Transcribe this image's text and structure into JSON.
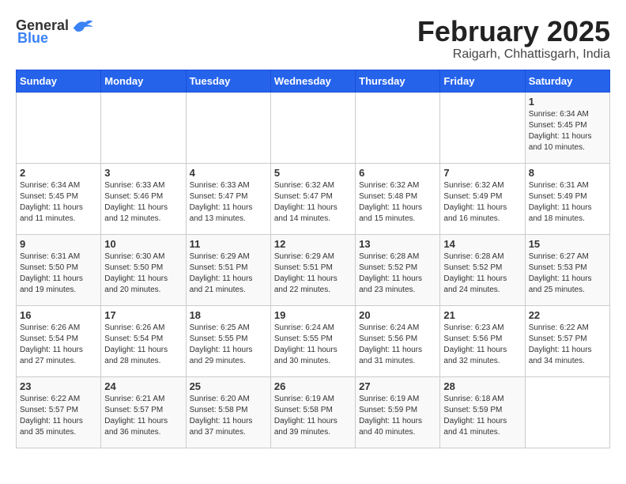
{
  "logo": {
    "general": "General",
    "blue": "Blue"
  },
  "title": "February 2025",
  "subtitle": "Raigarh, Chhattisgarh, India",
  "days_of_week": [
    "Sunday",
    "Monday",
    "Tuesday",
    "Wednesday",
    "Thursday",
    "Friday",
    "Saturday"
  ],
  "weeks": [
    [
      {
        "day": "",
        "info": ""
      },
      {
        "day": "",
        "info": ""
      },
      {
        "day": "",
        "info": ""
      },
      {
        "day": "",
        "info": ""
      },
      {
        "day": "",
        "info": ""
      },
      {
        "day": "",
        "info": ""
      },
      {
        "day": "1",
        "info": "Sunrise: 6:34 AM\nSunset: 5:45 PM\nDaylight: 11 hours\nand 10 minutes."
      }
    ],
    [
      {
        "day": "2",
        "info": "Sunrise: 6:34 AM\nSunset: 5:45 PM\nDaylight: 11 hours\nand 11 minutes."
      },
      {
        "day": "3",
        "info": "Sunrise: 6:33 AM\nSunset: 5:46 PM\nDaylight: 11 hours\nand 12 minutes."
      },
      {
        "day": "4",
        "info": "Sunrise: 6:33 AM\nSunset: 5:47 PM\nDaylight: 11 hours\nand 13 minutes."
      },
      {
        "day": "5",
        "info": "Sunrise: 6:32 AM\nSunset: 5:47 PM\nDaylight: 11 hours\nand 14 minutes."
      },
      {
        "day": "6",
        "info": "Sunrise: 6:32 AM\nSunset: 5:48 PM\nDaylight: 11 hours\nand 15 minutes."
      },
      {
        "day": "7",
        "info": "Sunrise: 6:32 AM\nSunset: 5:49 PM\nDaylight: 11 hours\nand 16 minutes."
      },
      {
        "day": "8",
        "info": "Sunrise: 6:31 AM\nSunset: 5:49 PM\nDaylight: 11 hours\nand 18 minutes."
      }
    ],
    [
      {
        "day": "9",
        "info": "Sunrise: 6:31 AM\nSunset: 5:50 PM\nDaylight: 11 hours\nand 19 minutes."
      },
      {
        "day": "10",
        "info": "Sunrise: 6:30 AM\nSunset: 5:50 PM\nDaylight: 11 hours\nand 20 minutes."
      },
      {
        "day": "11",
        "info": "Sunrise: 6:29 AM\nSunset: 5:51 PM\nDaylight: 11 hours\nand 21 minutes."
      },
      {
        "day": "12",
        "info": "Sunrise: 6:29 AM\nSunset: 5:51 PM\nDaylight: 11 hours\nand 22 minutes."
      },
      {
        "day": "13",
        "info": "Sunrise: 6:28 AM\nSunset: 5:52 PM\nDaylight: 11 hours\nand 23 minutes."
      },
      {
        "day": "14",
        "info": "Sunrise: 6:28 AM\nSunset: 5:52 PM\nDaylight: 11 hours\nand 24 minutes."
      },
      {
        "day": "15",
        "info": "Sunrise: 6:27 AM\nSunset: 5:53 PM\nDaylight: 11 hours\nand 25 minutes."
      }
    ],
    [
      {
        "day": "16",
        "info": "Sunrise: 6:26 AM\nSunset: 5:54 PM\nDaylight: 11 hours\nand 27 minutes."
      },
      {
        "day": "17",
        "info": "Sunrise: 6:26 AM\nSunset: 5:54 PM\nDaylight: 11 hours\nand 28 minutes."
      },
      {
        "day": "18",
        "info": "Sunrise: 6:25 AM\nSunset: 5:55 PM\nDaylight: 11 hours\nand 29 minutes."
      },
      {
        "day": "19",
        "info": "Sunrise: 6:24 AM\nSunset: 5:55 PM\nDaylight: 11 hours\nand 30 minutes."
      },
      {
        "day": "20",
        "info": "Sunrise: 6:24 AM\nSunset: 5:56 PM\nDaylight: 11 hours\nand 31 minutes."
      },
      {
        "day": "21",
        "info": "Sunrise: 6:23 AM\nSunset: 5:56 PM\nDaylight: 11 hours\nand 32 minutes."
      },
      {
        "day": "22",
        "info": "Sunrise: 6:22 AM\nSunset: 5:57 PM\nDaylight: 11 hours\nand 34 minutes."
      }
    ],
    [
      {
        "day": "23",
        "info": "Sunrise: 6:22 AM\nSunset: 5:57 PM\nDaylight: 11 hours\nand 35 minutes."
      },
      {
        "day": "24",
        "info": "Sunrise: 6:21 AM\nSunset: 5:57 PM\nDaylight: 11 hours\nand 36 minutes."
      },
      {
        "day": "25",
        "info": "Sunrise: 6:20 AM\nSunset: 5:58 PM\nDaylight: 11 hours\nand 37 minutes."
      },
      {
        "day": "26",
        "info": "Sunrise: 6:19 AM\nSunset: 5:58 PM\nDaylight: 11 hours\nand 39 minutes."
      },
      {
        "day": "27",
        "info": "Sunrise: 6:19 AM\nSunset: 5:59 PM\nDaylight: 11 hours\nand 40 minutes."
      },
      {
        "day": "28",
        "info": "Sunrise: 6:18 AM\nSunset: 5:59 PM\nDaylight: 11 hours\nand 41 minutes."
      },
      {
        "day": "",
        "info": ""
      }
    ]
  ]
}
